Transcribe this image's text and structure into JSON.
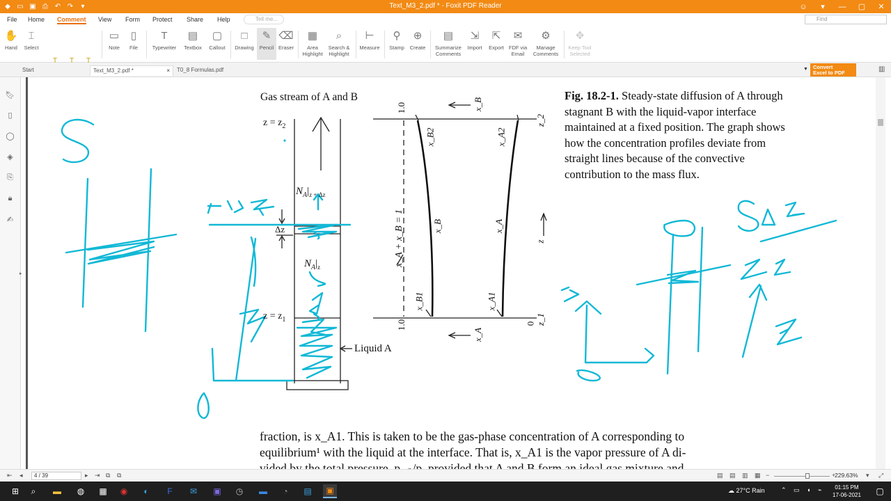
{
  "window": {
    "title": "Text_M3_2.pdf * - Foxit PDF Reader"
  },
  "menu": [
    "File",
    "Home",
    "Comment",
    "View",
    "Form",
    "Protect",
    "Share",
    "Help"
  ],
  "active_menu": "Comment",
  "tell_me_placeholder": "Tell me...",
  "find_placeholder": "Find",
  "ribbon": {
    "hand": "Hand",
    "select": "Select",
    "note": "Note",
    "file": "File",
    "typewriter": "Typewriter",
    "textbox": "Textbox",
    "callout": "Callout",
    "drawing": "Drawing",
    "pencil": "Pencil",
    "eraser": "Eraser",
    "area_highlight_1": "Area",
    "area_highlight_2": "Highlight",
    "search_highlight_1": "Search &",
    "search_highlight_2": "Highlight",
    "measure": "Measure",
    "stamp": "Stamp",
    "create": "Create",
    "summarize_1": "Summarize",
    "summarize_2": "Comments",
    "import": "Import",
    "export": "Export",
    "fdf_1": "FDF via",
    "fdf_2": "Email",
    "manage_1": "Manage",
    "manage_2": "Comments",
    "keep_tool_1": "Keep Tool",
    "keep_tool_2": "Selected"
  },
  "tabs": [
    {
      "label": "Start"
    },
    {
      "label": "Text_M3_2.pdf *"
    },
    {
      "label": "T0_8 Formulas.pdf"
    }
  ],
  "convert_banner": {
    "line1": "Convert",
    "line2": "Excel to PDF"
  },
  "document": {
    "header_label": "Gas stream of A and B",
    "z2_label": "z = z",
    "z2_sub": "2",
    "z1_label": "z = z",
    "z1_sub": "1",
    "dz_label": "Δz",
    "na_top": "N",
    "na_top_sub": "A",
    "na_top_eval": "z + Δz",
    "na_bottom": "N",
    "na_bottom_sub": "A",
    "na_bottom_eval": "z",
    "liquid_label": "Liquid A",
    "axis_top_value": "1.0",
    "axis_bottom_value": "1.0",
    "axis_zero": "0",
    "xa_plus_xb": "x_A + x_B = 1",
    "xb_top_arrow": "x_B",
    "xa_bottom_arrow": "x_A",
    "xb2": "x_B2",
    "xa2": "x_A2",
    "xb": "x_B",
    "xa": "x_A",
    "xb1": "x_B1",
    "xa1": "x_A1",
    "z_axis": "z",
    "z2_right": "z_2",
    "z1_right": "z_1",
    "caption_bold": "Fig. 18.2-1.",
    "caption_text": "Steady-state diffusion of A through stagnant B with the liquid-vapor interface maintained at a fixed position. The graph shows how the concentration profiles deviate from straight lines because of the convective contribution to the mass flux.",
    "para_line1": "fraction, is x_A1. This is taken to be the gas-phase concentration of A corresponding to",
    "para_line2": "equilibrium¹ with the liquid at the interface. That is, x_A1 is the vapor pressure of A di-",
    "para_line3": "vided by the total pressure, pᵥₐₚ/p, provided that A and B form an ideal gas mixture and"
  },
  "annotation_color": "#12b8d6",
  "status": {
    "page": "4 / 39",
    "zoom": "229.63%"
  },
  "taskbar": {
    "weather": "27°C  Rain",
    "time": "01:15 PM",
    "date": "17-06-2021"
  }
}
